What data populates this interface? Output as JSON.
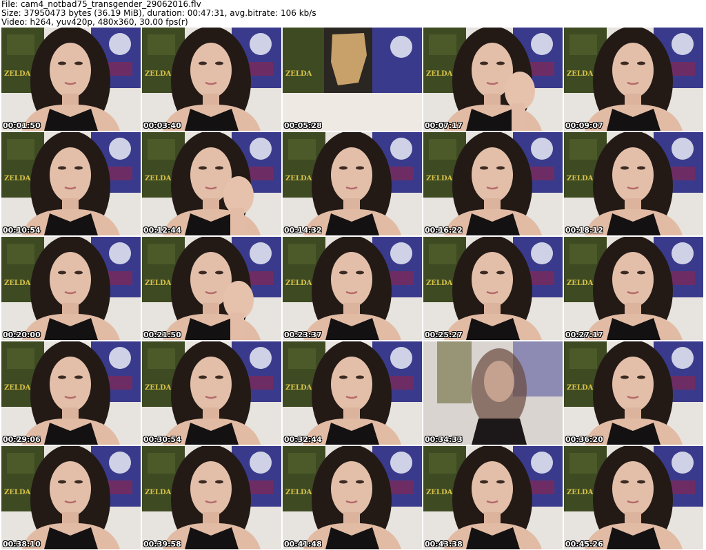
{
  "header": {
    "line1": "File: cam4_notbad75_transgender_29062016.flv",
    "line2": "Size: 37950473 bytes (36.19 MiB), duration: 00:47:31, avg.bitrate: 106 kb/s",
    "line3": "Video: h264, yuv420p, 480x360, 30.00 fps(r)"
  },
  "poster_text": "ZELDA",
  "thumbnails": [
    {
      "time": "00:01:50",
      "scene": "face"
    },
    {
      "time": "00:03:40",
      "scene": "face"
    },
    {
      "time": "00:05:28",
      "scene": "posters"
    },
    {
      "time": "00:07:17",
      "scene": "hand"
    },
    {
      "time": "00:09:07",
      "scene": "face"
    },
    {
      "time": "00:10:54",
      "scene": "face"
    },
    {
      "time": "00:12:44",
      "scene": "hand"
    },
    {
      "time": "00:14:32",
      "scene": "face"
    },
    {
      "time": "00:16:22",
      "scene": "face"
    },
    {
      "time": "00:18:12",
      "scene": "face"
    },
    {
      "time": "00:20:00",
      "scene": "face"
    },
    {
      "time": "00:21:50",
      "scene": "hand"
    },
    {
      "time": "00:23:37",
      "scene": "face"
    },
    {
      "time": "00:25:27",
      "scene": "face"
    },
    {
      "time": "00:27:17",
      "scene": "face"
    },
    {
      "time": "00:29:06",
      "scene": "face"
    },
    {
      "time": "00:30:54",
      "scene": "face"
    },
    {
      "time": "00:32:44",
      "scene": "face"
    },
    {
      "time": "00:34:33",
      "scene": "blur"
    },
    {
      "time": "00:36:20",
      "scene": "face"
    },
    {
      "time": "00:38:10",
      "scene": "face"
    },
    {
      "time": "00:39:58",
      "scene": "face"
    },
    {
      "time": "00:41:48",
      "scene": "face"
    },
    {
      "time": "00:43:38",
      "scene": "face"
    },
    {
      "time": "00:45:26",
      "scene": "face"
    }
  ]
}
